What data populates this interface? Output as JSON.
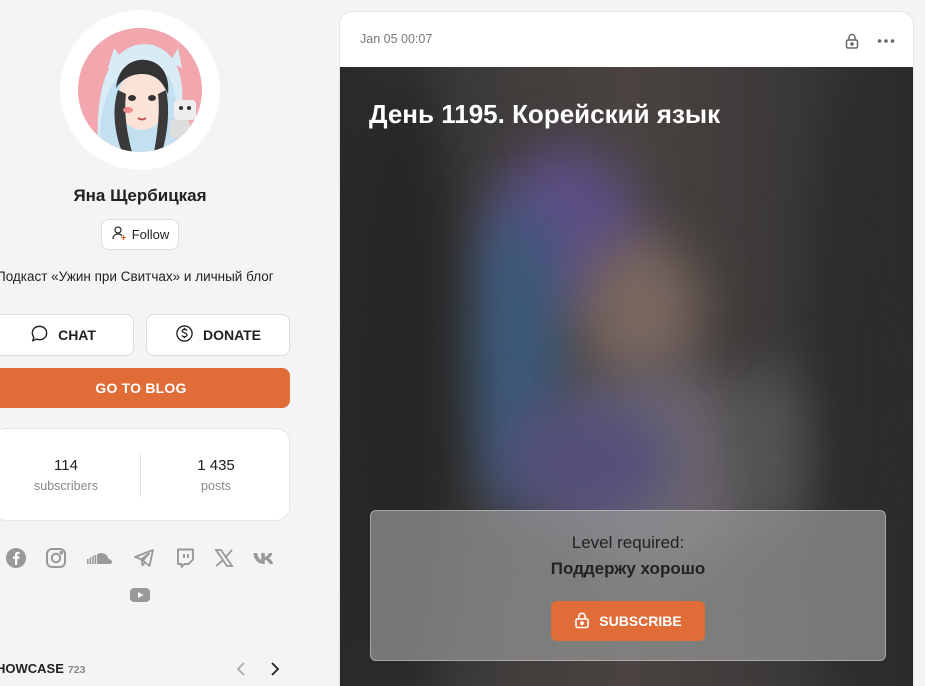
{
  "author": {
    "name": "Яна Щербицкая",
    "follow_label": "Follow",
    "bio": "Подкаст «Ужин при Свитчах» и личный блог"
  },
  "actions": {
    "chat_label": "CHAT",
    "donate_label": "DONATE",
    "blog_label": "GO TO BLOG"
  },
  "stats": {
    "subscribers_value": "114",
    "subscribers_label": "subscribers",
    "posts_value": "1 435",
    "posts_label": "posts"
  },
  "socials": [
    "facebook-icon",
    "instagram-icon",
    "soundcloud-icon",
    "telegram-icon",
    "twitch-icon",
    "x-icon",
    "vk-icon",
    "youtube-icon"
  ],
  "showcase": {
    "label": "HOWCASE",
    "count": "723"
  },
  "post": {
    "date": "Jan 05 00:07",
    "title": "День 1195. Корейский язык",
    "level_label": "Level required:",
    "level_name": "Поддержу хорошо",
    "subscribe_label": "SUBSCRIBE"
  },
  "colors": {
    "accent": "#e06c37",
    "background": "#f4f4f4"
  }
}
